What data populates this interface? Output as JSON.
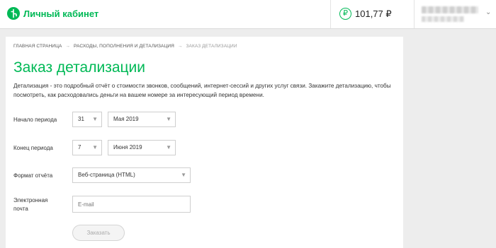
{
  "header": {
    "brand": "Личный кабинет",
    "balance": "101,77 ₽",
    "ruble_symbol": "₽",
    "brand_color": "#00b956"
  },
  "breadcrumbs": {
    "home": "ГЛАВНАЯ СТРАНИЦА",
    "section": "РАСХОДЫ, ПОПОЛНЕНИЯ И ДЕТАЛИЗАЦИЯ",
    "current": "ЗАКАЗ ДЕТАЛИЗАЦИИ",
    "separator": "→"
  },
  "page": {
    "title": "Заказ детализации",
    "description": "Детализация - это подробный отчёт о стоимости звонков, сообщений, интернет-сессий и других услуг связи. Закажите детализацию, чтобы посмотреть, как расходовались деньги на вашем номере за интересующий период времени."
  },
  "form": {
    "start_label": "Начало периода",
    "start_day": "31",
    "start_month": "Мая 2019",
    "end_label": "Конец периода",
    "end_day": "7",
    "end_month": "Июня 2019",
    "format_label": "Формат отчёта",
    "format_value": "Веб-страница (HTML)",
    "email_label": "Электронная почта",
    "email_placeholder": "E-mail",
    "submit_label": "Заказать"
  },
  "icons": {
    "dropdown": "chevron-down-icon",
    "currency": "ruble-icon",
    "logo": "megafon-logo-icon"
  }
}
